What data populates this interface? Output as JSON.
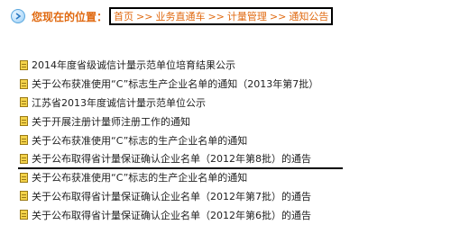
{
  "breadcrumb": {
    "prefix": "您现在的位置：",
    "items": [
      "首页",
      "业务直通车",
      "计量管理",
      "通知公告"
    ],
    "separator": ">>"
  },
  "news": {
    "items": [
      {
        "title": "2014年度省级诚信计量示范单位培育结果公示"
      },
      {
        "title": "关于公布获准使用“C”标志生产企业名单的通知（2013年第7批）"
      },
      {
        "title": "江苏省2013年度诚信计量示范单位公示"
      },
      {
        "title": "关于开展注册计量师注册工作的通知"
      },
      {
        "title": "关于公布获准使用“C”标志的生产企业名单的通知"
      },
      {
        "title": "关于公布取得省计量保证确认企业名单（2012年第8批）的通告"
      },
      {
        "title": "关于公布获准使用“C”标志的生产企业名单的通知"
      },
      {
        "title": "关于公布取得省计量保证确认企业名单（2012年第7批）的通告"
      },
      {
        "title": "关于公布取得省计量保证确认企业名单（2012年第6批）的通告"
      }
    ]
  },
  "icons": {
    "breadcrumb": "arrow-right-circle-icon",
    "list_item": "document-icon"
  },
  "colors": {
    "accent": "#e06a11",
    "text": "#222222",
    "highlight_box": "#000000"
  }
}
